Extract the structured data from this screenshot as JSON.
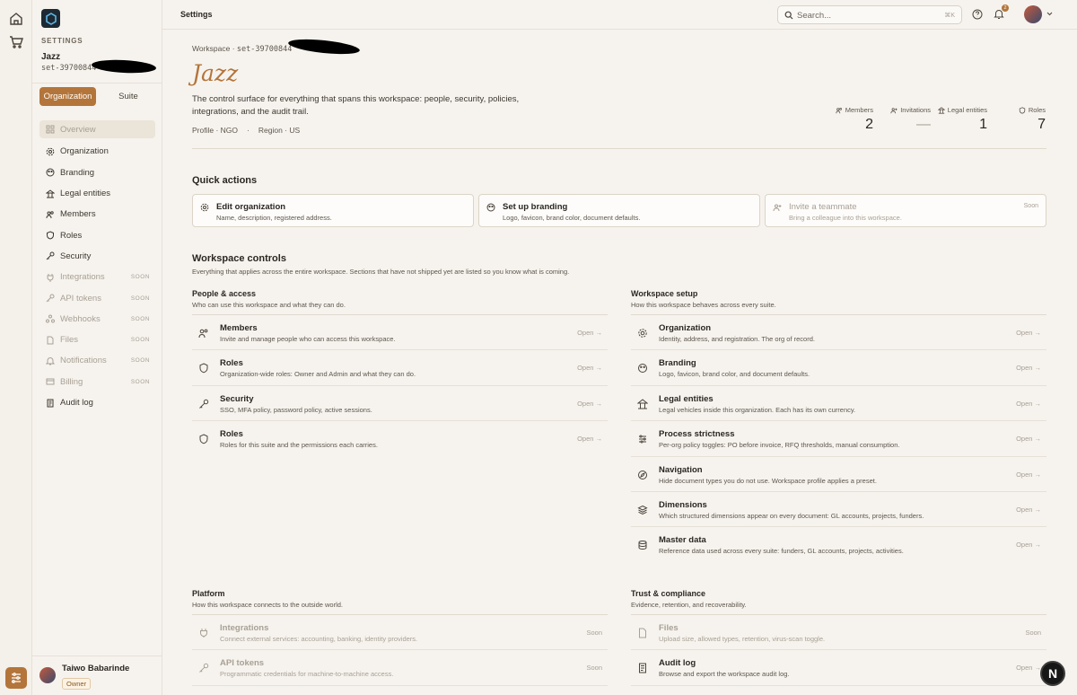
{
  "app": {
    "section": "Settings",
    "workspace_name": "Jazz",
    "workspace_id": "set-39700844",
    "settings_label": "SETTINGS",
    "accent": "#b3753a"
  },
  "sidebar": {
    "tabs": [
      "Organization",
      "Suite"
    ],
    "items": [
      {
        "label": "Overview",
        "soon": ""
      },
      {
        "label": "Organization",
        "soon": ""
      },
      {
        "label": "Branding",
        "soon": ""
      },
      {
        "label": "Legal entities",
        "soon": ""
      },
      {
        "label": "Members",
        "soon": ""
      },
      {
        "label": "Roles",
        "soon": ""
      },
      {
        "label": "Security",
        "soon": ""
      },
      {
        "label": "Integrations",
        "soon": "SOON"
      },
      {
        "label": "API tokens",
        "soon": "SOON"
      },
      {
        "label": "Webhooks",
        "soon": "SOON"
      },
      {
        "label": "Files",
        "soon": "SOON"
      },
      {
        "label": "Notifications",
        "soon": "SOON"
      },
      {
        "label": "Billing",
        "soon": "SOON"
      },
      {
        "label": "Audit log",
        "soon": ""
      }
    ]
  },
  "user": {
    "name": "Taiwo Babarinde",
    "role": "Owner"
  },
  "topbar": {
    "title": "Settings",
    "search_placeholder": "Search...",
    "shortcut": "⌘K",
    "notifications": "2"
  },
  "header": {
    "breadcrumb_prefix": "Workspace · ",
    "breadcrumb_id": "set-39700844",
    "title": "Jazz",
    "description": "The control surface for everything that spans this workspace: people, security, policies, integrations, and the audit trail.",
    "profile": "Profile · NGO",
    "region": "Region · US"
  },
  "stats": [
    {
      "label": "Members",
      "value": "2"
    },
    {
      "label": "Invitations",
      "value": "—"
    },
    {
      "label": "Legal entities",
      "value": "1"
    },
    {
      "label": "Roles",
      "value": "7"
    }
  ],
  "quick": {
    "title": "Quick actions",
    "items": [
      {
        "title": "Edit organization",
        "desc": "Name, description, registered address.",
        "soon": ""
      },
      {
        "title": "Set up branding",
        "desc": "Logo, favicon, brand color, document defaults.",
        "soon": ""
      },
      {
        "title": "Invite a teammate",
        "desc": "Bring a colleague into this workspace.",
        "soon": "Soon"
      }
    ]
  },
  "controls": {
    "title": "Workspace controls",
    "desc": "Everything that applies across the entire workspace. Sections that have not shipped yet are listed so you know what is coming.",
    "people": {
      "title": "People & access",
      "desc": "Who can use this workspace and what they can do.",
      "rows": [
        {
          "title": "Members",
          "desc": "Invite and manage people who can access this workspace.",
          "action": "Open →"
        },
        {
          "title": "Roles",
          "desc": "Organization-wide roles: Owner and Admin and what they can do.",
          "action": "Open →"
        },
        {
          "title": "Security",
          "desc": "SSO, MFA policy, password policy, active sessions.",
          "action": "Open →"
        },
        {
          "title": "Roles",
          "desc": "Roles for this suite and the permissions each carries.",
          "action": "Open →"
        }
      ]
    },
    "setup": {
      "title": "Workspace setup",
      "desc": "How this workspace behaves across every suite.",
      "rows": [
        {
          "title": "Organization",
          "desc": "Identity, address, and registration. The org of record.",
          "action": "Open →"
        },
        {
          "title": "Branding",
          "desc": "Logo, favicon, brand color, and document defaults.",
          "action": "Open →"
        },
        {
          "title": "Legal entities",
          "desc": "Legal vehicles inside this organization. Each has its own currency.",
          "action": "Open →"
        },
        {
          "title": "Process strictness",
          "desc": "Per-org policy toggles: PO before invoice, RFQ thresholds, manual consumption.",
          "action": "Open →"
        },
        {
          "title": "Navigation",
          "desc": "Hide document types you do not use. Workspace profile applies a preset.",
          "action": "Open →"
        },
        {
          "title": "Dimensions",
          "desc": "Which structured dimensions appear on every document: GL accounts, projects, funders.",
          "action": "Open →"
        },
        {
          "title": "Master data",
          "desc": "Reference data used across every suite: funders, GL accounts, projects, activities.",
          "action": "Open →"
        }
      ]
    },
    "platform": {
      "title": "Platform",
      "desc": "How this workspace connects to the outside world.",
      "rows": [
        {
          "title": "Integrations",
          "desc": "Connect external services: accounting, banking, identity providers.",
          "action": "Soon"
        },
        {
          "title": "API tokens",
          "desc": "Programmatic credentials for machine-to-machine access.",
          "action": "Soon"
        }
      ]
    },
    "trust": {
      "title": "Trust & compliance",
      "desc": "Evidence, retention, and recoverability.",
      "rows": [
        {
          "title": "Files",
          "desc": "Upload size, allowed types, retention, virus-scan toggle.",
          "action": "Soon"
        },
        {
          "title": "Audit log",
          "desc": "Browse and export the workspace audit log.",
          "action": "Open →"
        }
      ]
    }
  },
  "fab": {
    "label": "N"
  }
}
